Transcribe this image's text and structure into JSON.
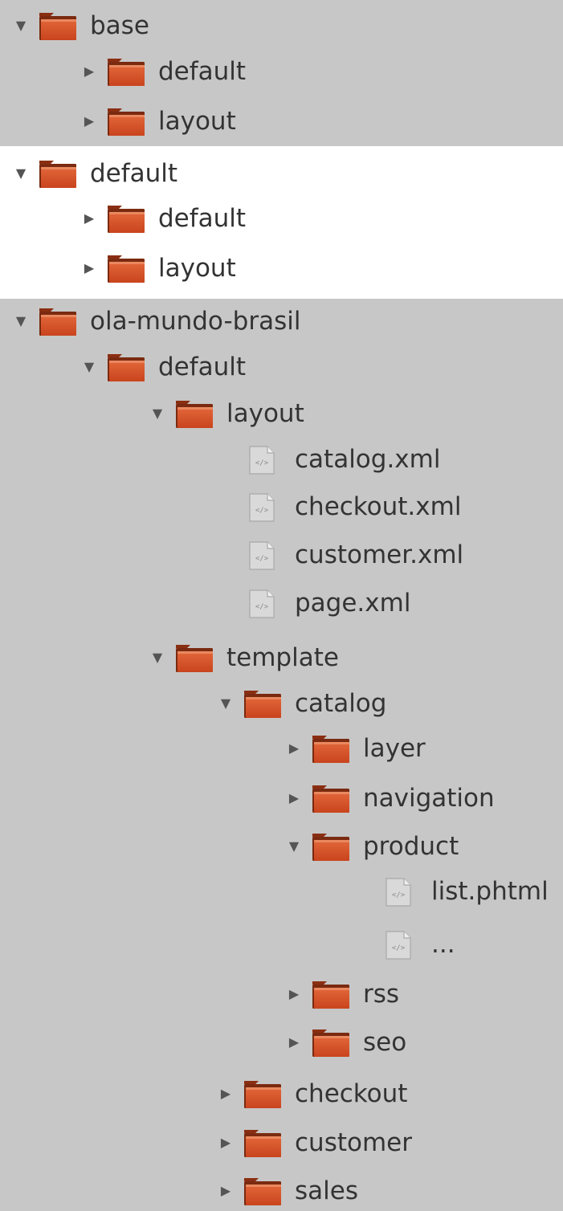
{
  "colors": {
    "background": "#c7c7c7",
    "selected_background": "#ffffff",
    "folder": "#c9441d",
    "file": "#d9d9d9",
    "text": "#333333"
  },
  "tree": [
    {
      "label": "base",
      "type": "folder",
      "expanded": true,
      "depth": 0,
      "selected": false
    },
    {
      "label": "default",
      "type": "folder",
      "expanded": false,
      "depth": 1,
      "selected": false
    },
    {
      "label": "layout",
      "type": "folder",
      "expanded": false,
      "depth": 1,
      "selected": false
    },
    {
      "label": "default",
      "type": "folder",
      "expanded": true,
      "depth": 0,
      "selected": true
    },
    {
      "label": "default",
      "type": "folder",
      "expanded": false,
      "depth": 1,
      "selected": true
    },
    {
      "label": "layout",
      "type": "folder",
      "expanded": false,
      "depth": 1,
      "selected": true
    },
    {
      "label": "ola-mundo-brasil",
      "type": "folder",
      "expanded": true,
      "depth": 0,
      "selected": false
    },
    {
      "label": "default",
      "type": "folder",
      "expanded": true,
      "depth": 1,
      "selected": false
    },
    {
      "label": "layout",
      "type": "folder",
      "expanded": true,
      "depth": 2,
      "selected": false
    },
    {
      "label": "catalog.xml",
      "type": "file",
      "depth": 3,
      "selected": false
    },
    {
      "label": "checkout.xml",
      "type": "file",
      "depth": 3,
      "selected": false
    },
    {
      "label": "customer.xml",
      "type": "file",
      "depth": 3,
      "selected": false
    },
    {
      "label": "page.xml",
      "type": "file",
      "depth": 3,
      "selected": false
    },
    {
      "label": "template",
      "type": "folder",
      "expanded": true,
      "depth": 2,
      "selected": false
    },
    {
      "label": "catalog",
      "type": "folder",
      "expanded": true,
      "depth": 3,
      "selected": false
    },
    {
      "label": "layer",
      "type": "folder",
      "expanded": false,
      "depth": 4,
      "selected": false
    },
    {
      "label": "navigation",
      "type": "folder",
      "expanded": false,
      "depth": 4,
      "selected": false
    },
    {
      "label": "product",
      "type": "folder",
      "expanded": true,
      "depth": 4,
      "selected": false
    },
    {
      "label": "list.phtml",
      "type": "file",
      "depth": 5,
      "selected": false
    },
    {
      "label": "...",
      "type": "file",
      "depth": 5,
      "selected": false
    },
    {
      "label": "rss",
      "type": "folder",
      "expanded": false,
      "depth": 4,
      "selected": false
    },
    {
      "label": "seo",
      "type": "folder",
      "expanded": false,
      "depth": 4,
      "selected": false
    },
    {
      "label": "checkout",
      "type": "folder",
      "expanded": false,
      "depth": 3,
      "selected": false
    },
    {
      "label": "customer",
      "type": "folder",
      "expanded": false,
      "depth": 3,
      "selected": false
    },
    {
      "label": "sales",
      "type": "folder",
      "expanded": false,
      "depth": 3,
      "selected": false
    }
  ]
}
